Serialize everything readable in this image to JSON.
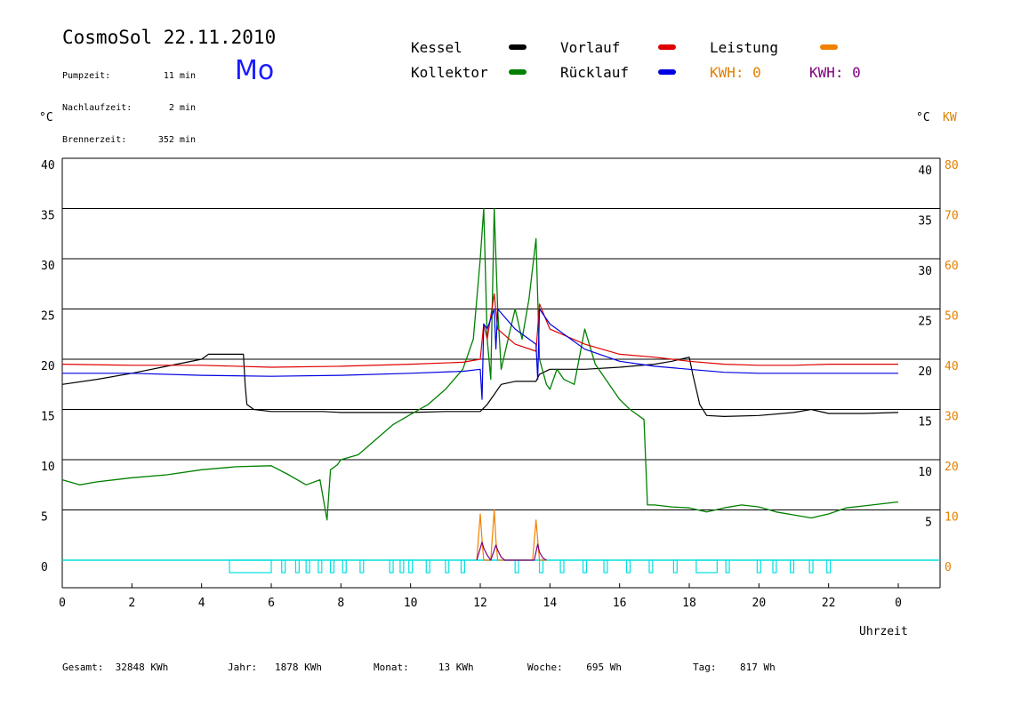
{
  "header": {
    "title": "CosmoSol 22.11.2010",
    "day": "Mo",
    "stats": [
      {
        "label": "Pumpzeit:",
        "value": "11 min"
      },
      {
        "label": "Nachlaufzeit:",
        "value": "2 min"
      },
      {
        "label": "Brennerzeit:",
        "value": "352 min"
      }
    ]
  },
  "legend": {
    "kessel": "Kessel",
    "kollektor": "Kollektor",
    "vorlauf": "Vorlauf",
    "ruecklauf": "Rücklauf",
    "leistung": "Leistung",
    "kwh_orange": "KWH: 0",
    "kwh_purple": "KWH: 0"
  },
  "colors": {
    "kessel": "#000000",
    "kollektor": "#008000",
    "vorlauf": "#e00000",
    "ruecklauf": "#0000e0",
    "leistung": "#f08000",
    "kwh_purple": "#800080",
    "pump": "#00e0e0",
    "grid": "#000000",
    "axis_right_kw": "#e08000"
  },
  "footer": [
    {
      "label": "Gesamt:",
      "value": "32848 KWh"
    },
    {
      "label": "Jahr:",
      "value": "1878 KWh"
    },
    {
      "label": "Monat:",
      "value": "13 KWh"
    },
    {
      "label": "Woche:",
      "value": "695 Wh"
    },
    {
      "label": "Tag:",
      "value": "817 Wh"
    }
  ],
  "chart_data": {
    "type": "line",
    "xlabel": "Uhrzeit",
    "ylabel_left": "°C",
    "ylabel_right": "°C",
    "ylabel_right2": "KW",
    "xlim": [
      0,
      24
    ],
    "ylim": [
      0,
      40
    ],
    "ylim_right2": [
      0,
      80
    ],
    "x_ticks": [
      "0",
      "2",
      "4",
      "6",
      "8",
      "10",
      "12",
      "14",
      "16",
      "18",
      "20",
      "22",
      "0"
    ],
    "y_ticks_left": [
      "0",
      "5",
      "10",
      "15",
      "20",
      "25",
      "30",
      "35",
      "40"
    ],
    "y_ticks_right": [
      "5",
      "10",
      "15",
      "20",
      "25",
      "30",
      "35",
      "40"
    ],
    "y_ticks_right2": [
      "0",
      "10",
      "20",
      "30",
      "40",
      "50",
      "60",
      "70",
      "80"
    ],
    "grid": true,
    "series": [
      {
        "name": "Kessel",
        "color": "#000000",
        "x": [
          0,
          1,
          2,
          3,
          4,
          4.2,
          5.2,
          5.25,
          5.3,
          5.5,
          6,
          7.5,
          8,
          10,
          11,
          12,
          12.2,
          12.4,
          12.6,
          13,
          13.6,
          13.7,
          14,
          15,
          16,
          17,
          17.5,
          18,
          18.1,
          18.3,
          18.5,
          19,
          20,
          21,
          21.5,
          22,
          23,
          24
        ],
        "y": [
          17.5,
          18,
          18.6,
          19.3,
          20,
          20.5,
          20.5,
          17.5,
          15.5,
          15,
          14.8,
          14.8,
          14.7,
          14.7,
          14.8,
          14.8,
          15.5,
          16.5,
          17.5,
          17.8,
          17.8,
          18.5,
          19,
          19,
          19.2,
          19.5,
          19.8,
          20.2,
          18.5,
          15.5,
          14.4,
          14.3,
          14.4,
          14.7,
          15,
          14.6,
          14.6,
          14.7
        ]
      },
      {
        "name": "Kollektor",
        "color": "#008000",
        "x": [
          0,
          0.5,
          1,
          2,
          3,
          4,
          5,
          6,
          6.5,
          7,
          7.4,
          7.6,
          7.7,
          7.9,
          8,
          8.5,
          9,
          9.5,
          10,
          10.5,
          11,
          11.5,
          11.8,
          12,
          12.1,
          12.2,
          12.3,
          12.4,
          12.5,
          12.6,
          12.8,
          13,
          13.2,
          13.4,
          13.6,
          13.7,
          13.9,
          14,
          14.2,
          14.4,
          14.7,
          15,
          15.3,
          15.5,
          16,
          16.3,
          16.7,
          16.8,
          17,
          17.5,
          18,
          18.5,
          19,
          19.5,
          20,
          20.5,
          21,
          21.5,
          22,
          22.5,
          23,
          24
        ],
        "y": [
          8,
          7.5,
          7.8,
          8.2,
          8.5,
          9,
          9.3,
          9.4,
          8.5,
          7.5,
          8,
          4,
          9,
          9.5,
          10,
          10.5,
          12,
          13.5,
          14.5,
          15.5,
          17,
          19,
          22,
          30,
          35,
          22,
          18,
          35,
          25,
          19,
          22,
          25,
          22,
          26,
          32,
          20,
          17.5,
          17,
          19,
          18,
          17.5,
          23,
          19.5,
          18.5,
          16,
          15,
          14,
          5.5,
          5.5,
          5.3,
          5.2,
          4.8,
          5.2,
          5.5,
          5.3,
          4.8,
          4.5,
          4.2,
          4.6,
          5.2,
          5.4,
          5.8
        ]
      },
      {
        "name": "Vorlauf",
        "color": "#e00000",
        "x": [
          0,
          2,
          4,
          6,
          8,
          10,
          11.5,
          12,
          12.1,
          12.2,
          12.4,
          12.5,
          13,
          13.6,
          13.7,
          14,
          15,
          16,
          17,
          18,
          19,
          20,
          21,
          22,
          23,
          24
        ],
        "y": [
          19.5,
          19.4,
          19.4,
          19.2,
          19.3,
          19.5,
          19.7,
          20,
          23.5,
          22,
          26.5,
          23,
          21.5,
          20.8,
          25.5,
          23,
          21.5,
          20.5,
          20.2,
          19.8,
          19.5,
          19.4,
          19.4,
          19.5,
          19.5,
          19.5
        ]
      },
      {
        "name": "Rücklauf",
        "color": "#0000e0",
        "x": [
          0,
          2,
          4,
          6,
          8,
          10,
          11.5,
          12,
          12.05,
          12.1,
          12.2,
          12.4,
          12.45,
          12.5,
          13,
          13.6,
          13.65,
          13.7,
          14,
          15,
          16,
          17,
          18,
          19,
          20,
          21,
          22,
          23,
          24
        ],
        "y": [
          18.6,
          18.6,
          18.4,
          18.3,
          18.4,
          18.6,
          18.8,
          19,
          16,
          23.5,
          23,
          25,
          21,
          25,
          23,
          21.5,
          18,
          25,
          23.5,
          21,
          19.8,
          19.3,
          19,
          18.7,
          18.6,
          18.6,
          18.6,
          18.6,
          18.6
        ]
      },
      {
        "name": "Leistung",
        "color": "#f08000",
        "x": [
          11.9,
          12,
          12.05,
          12.1,
          12.3,
          12.4,
          12.45,
          12.5,
          12.7,
          13.5,
          13.6,
          13.65,
          13.7,
          13.9
        ],
        "y": [
          0,
          4.6,
          2,
          0,
          0,
          5,
          2,
          0,
          0,
          0,
          4,
          2,
          0,
          0
        ]
      },
      {
        "name": "KWH",
        "color": "#800080",
        "x": [
          11.9,
          12.05,
          12.1,
          12.2,
          12.3,
          12.45,
          12.5,
          12.6,
          12.7,
          13.55,
          13.65,
          13.7,
          13.8,
          13.9
        ],
        "y": [
          0,
          1.8,
          1.2,
          0.5,
          0,
          1.5,
          1.0,
          0.3,
          0,
          0,
          1.6,
          0.8,
          0.2,
          0
        ]
      }
    ],
    "pump_intervals": [
      [
        4.8,
        6.0
      ],
      [
        6.3,
        6.4
      ],
      [
        6.7,
        6.8
      ],
      [
        7.0,
        7.1
      ],
      [
        7.35,
        7.45
      ],
      [
        7.7,
        7.8
      ],
      [
        8.05,
        8.15
      ],
      [
        8.55,
        8.65
      ],
      [
        9.4,
        9.5
      ],
      [
        9.7,
        9.8
      ],
      [
        9.95,
        10.05
      ],
      [
        10.45,
        10.55
      ],
      [
        11.0,
        11.1
      ],
      [
        11.45,
        11.55
      ],
      [
        13.0,
        13.1
      ],
      [
        13.7,
        13.8
      ],
      [
        14.3,
        14.4
      ],
      [
        14.95,
        15.05
      ],
      [
        15.55,
        15.65
      ],
      [
        16.2,
        16.3
      ],
      [
        16.85,
        16.95
      ],
      [
        17.55,
        17.65
      ],
      [
        18.2,
        18.8
      ],
      [
        19.05,
        19.15
      ],
      [
        19.95,
        20.05
      ],
      [
        20.4,
        20.5
      ],
      [
        20.9,
        21.0
      ],
      [
        21.45,
        21.55
      ],
      [
        21.95,
        22.05
      ]
    ]
  }
}
